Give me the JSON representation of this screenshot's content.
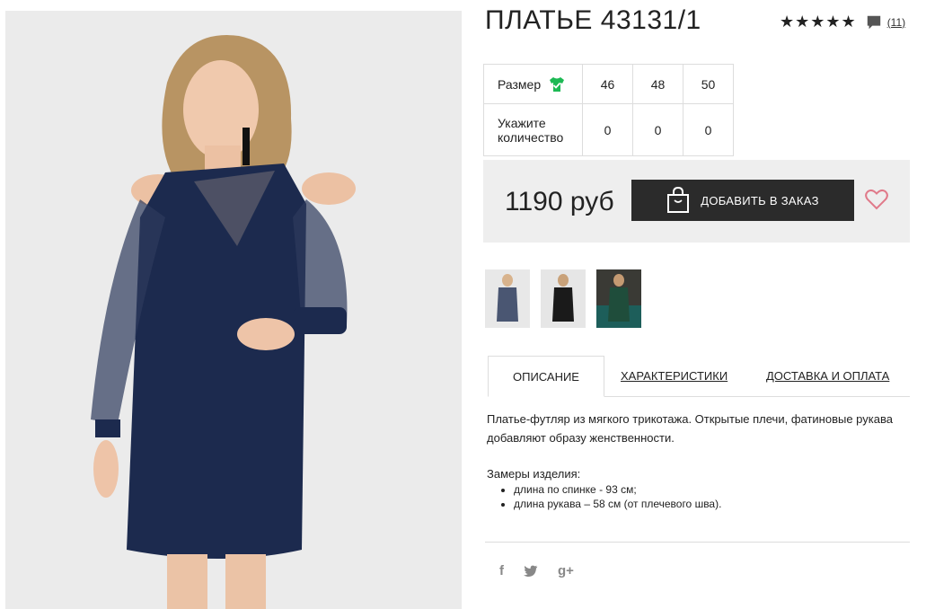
{
  "product": {
    "title": "ПЛАТЬЕ 43131/1",
    "rating_stars": "★★★★★",
    "review_count": "(11)",
    "price": "1190 руб",
    "add_to_order": "ДОБАВИТЬ В ЗАКАЗ"
  },
  "size_table": {
    "size_label": "Размер",
    "qty_label_line1": "Укажите",
    "qty_label_line2": "количество",
    "sizes": [
      "46",
      "48",
      "50"
    ],
    "quantities": [
      "0",
      "0",
      "0"
    ]
  },
  "tabs": {
    "description": "ОПИСАНИЕ",
    "specs": "ХАРАКТЕРИСТИКИ",
    "delivery": "ДОСТАВКА И ОПЛАТА"
  },
  "description": {
    "text": "Платье-футляр из мягкого трикотажа. Открытые плечи, фатиновые рукава добавляют образу женственности.",
    "measures_title": "Замеры изделия:",
    "measures": [
      "длина по спинке - 93 см;",
      "длина рукава – 58 см (от плечевого шва)."
    ]
  },
  "social": {
    "facebook": "f",
    "twitter": "🐦",
    "googleplus": "g+"
  },
  "colors": {
    "accent_green": "#1db954",
    "heart": "#e07a8a",
    "dress_navy": "#1c2a4e",
    "button_dark": "#2b2b2b"
  }
}
